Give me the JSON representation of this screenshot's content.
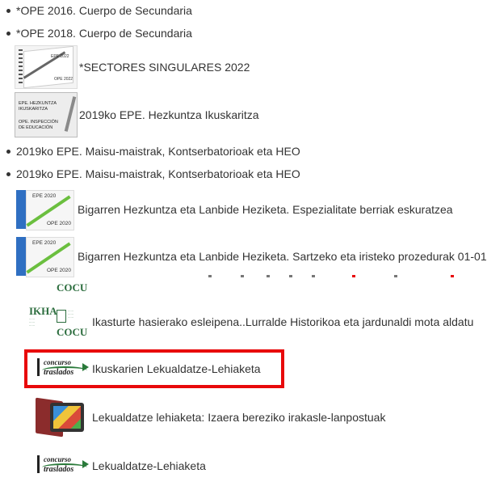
{
  "items": [
    {
      "text": "*OPE 2016. Cuerpo de Secundaria",
      "icon": "bullet"
    },
    {
      "text": "*OPE 2018. Cuerpo de Secundaria",
      "icon": "bullet"
    },
    {
      "text": "*SECTORES SINGULARES 2022",
      "icon": "ope-2022-notebook-thumbnail",
      "thumb_label_top": "EPE 2022",
      "thumb_label_bottom": "OPE 2022"
    },
    {
      "text": "2019ko EPE. Hezkuntza Ikuskaritza",
      "icon": "epe-hezkuntza-card-thumbnail",
      "thumb_line1": "EPE. HEZKUNTZA",
      "thumb_line2": "IKUSKARITZA",
      "thumb_line3": "OPE. INSPECCIÓN",
      "thumb_line4": "DE EDUCACIÓN"
    },
    {
      "text": "2019ko EPE. Maisu-maistrak, Kontserbatorioak eta HEO",
      "icon": "bullet"
    },
    {
      "text": "2019ko EPE. Maisu-maistrak, Kontserbatorioak eta HEO",
      "icon": "bullet"
    },
    {
      "text": "Bigarren Hezkuntza eta Lanbide Heziketa. Espezialitate berriak eskuratzea",
      "icon": "epe-2020-notebook-thumbnail",
      "thumb_label_top": "EPE 2020",
      "thumb_label_bottom": "OPE 2020"
    },
    {
      "text": "Bigarren Hezkuntza eta Lanbide Heziketa. Sartzeko eta iristeko prozedurak 01-01",
      "icon": "epe-2020-notebook-thumbnail",
      "thumb_label_top": "EPE 2020",
      "thumb_label_bottom": "OPE 2020"
    },
    {
      "text": "",
      "icon": "cocu-logo-partial",
      "thumb_label": "COCU"
    },
    {
      "text": "Ikasturte hasierako esleipena..Lurralde Historikoa eta jardunaldi mota aldatu",
      "icon": "ikha-cocu-logo",
      "thumb_label_top": "IKHA",
      "thumb_label": "COCU"
    },
    {
      "text": "Ikuskarien Lekualdatze-Lehiaketa",
      "icon": "concurso-traslados-logo",
      "thumb_word1": "concurso",
      "thumb_word2": "traslados",
      "highlighted": true
    },
    {
      "text": "Lekualdatze lehiaketa: Izaera bereziko irakasle-lanpostuak",
      "icon": "book-tablet-thumbnail"
    },
    {
      "text": "Lekualdatze-Lehiaketa",
      "icon": "concurso-traslados-logo",
      "thumb_word1": "concurso",
      "thumb_word2": "traslados"
    }
  ],
  "colors": {
    "text": "#333333",
    "highlight_border": "#e8090b"
  }
}
